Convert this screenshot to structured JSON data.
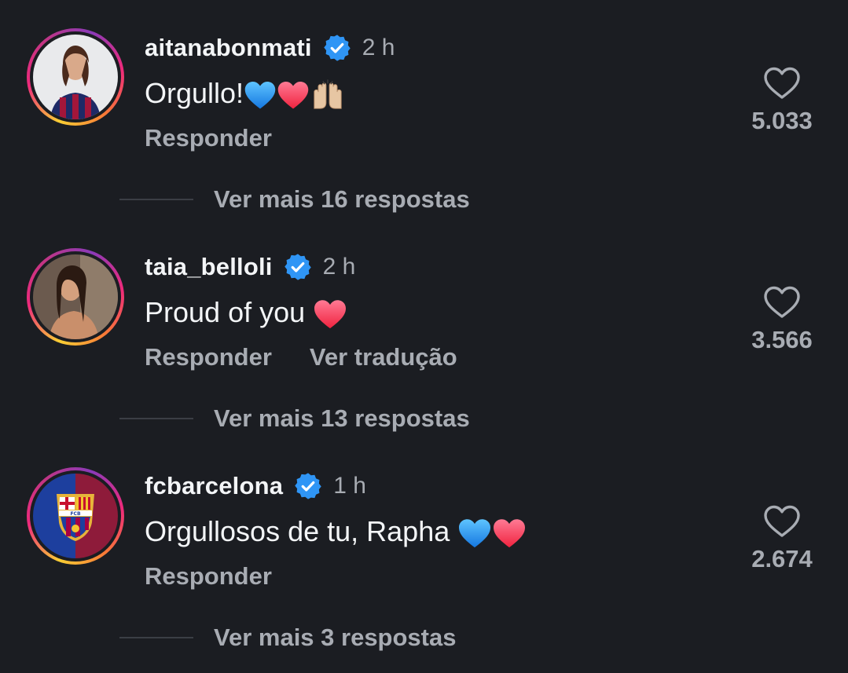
{
  "comments": [
    {
      "username": "aitanabonmati",
      "time": "2 h",
      "text": "Orgullo!",
      "reply_label": "Responder",
      "likes": "5.033",
      "more_replies": "Ver mais 16 respostas"
    },
    {
      "username": "taia_belloli",
      "time": "2 h",
      "text": "Proud of you",
      "reply_label": "Responder",
      "translate_label": "Ver tradução",
      "likes": "3.566",
      "more_replies": "Ver mais 13 respostas"
    },
    {
      "username": "fcbarcelona",
      "time": "1 h",
      "text": "Orgullosos de tu, Rapha",
      "reply_label": "Responder",
      "likes": "2.674",
      "more_replies": "Ver mais 3 respostas"
    }
  ],
  "icons": {
    "verified": "verified-badge-icon",
    "like": "heart-outline-icon",
    "blue_heart": "blue-heart-emoji",
    "red_heart": "red-heart-emoji",
    "raised_hands": "raised-hands-emoji"
  },
  "colors": {
    "background": "#1b1d22",
    "verified_blue": "#2f95f5",
    "secondary_text": "#a8acb3"
  }
}
